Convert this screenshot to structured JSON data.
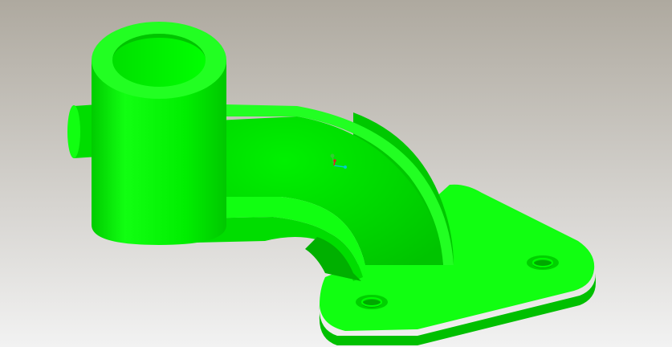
{
  "viewport": {
    "background_top": "#aea99f",
    "background_bottom": "#f0f0f0",
    "model_color": "#00ff00",
    "model_shade": "#00dd00",
    "model_dark": "#00b800",
    "model_light": "#33ff33"
  },
  "triad": {
    "x_axis_color": "#00cccc",
    "y_axis_color": "#33cc33",
    "z_axis_color": "#dd2222"
  }
}
